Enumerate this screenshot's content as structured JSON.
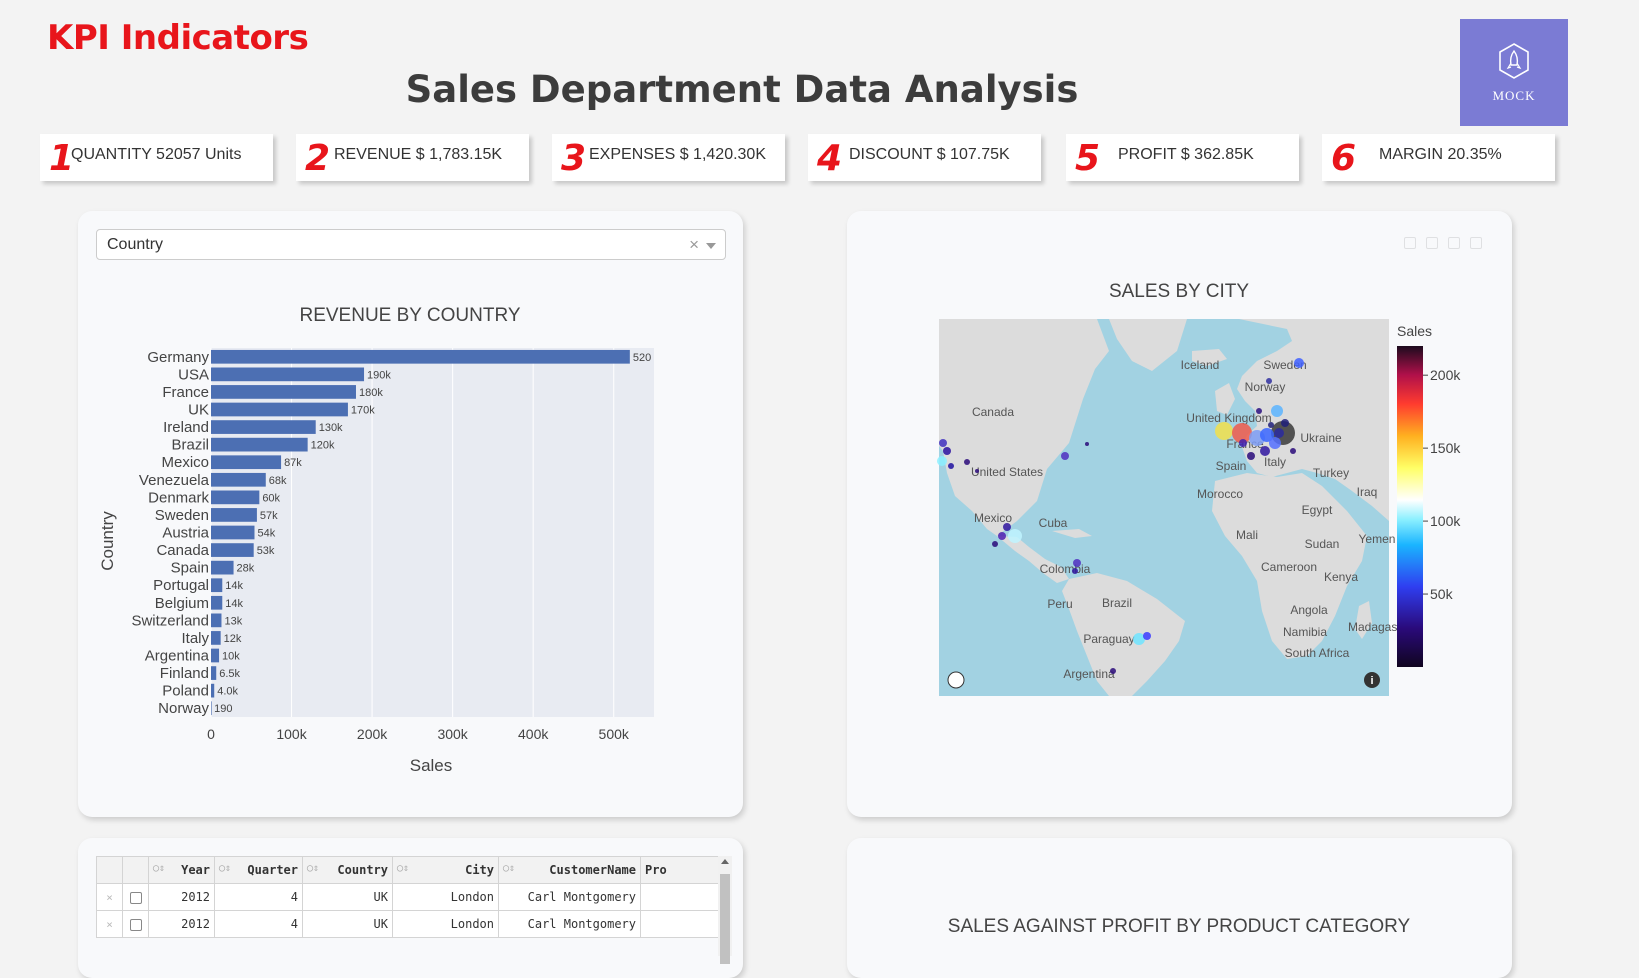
{
  "header": {
    "kpi_heading": "KPI Indicators",
    "page_title": "Sales Department Data Analysis",
    "logo_text": "MOCK",
    "logo_icon": "rocket-hexagon-icon"
  },
  "kpis": [
    {
      "num": "1",
      "label": "QUANTITY 52057 Units"
    },
    {
      "num": "2",
      "label": "REVENUE $ 1,783.15K"
    },
    {
      "num": "3",
      "label": "EXPENSES $ 1,420.30K"
    },
    {
      "num": "4",
      "label": "DISCOUNT $ 107.75K"
    },
    {
      "num": "5",
      "label": "PROFIT $ 362.85K"
    },
    {
      "num": "6",
      "label": "MARGIN 20.35%"
    }
  ],
  "country_filter": {
    "selected": "Country",
    "clear_glyph": "×"
  },
  "chart_data": [
    {
      "type": "bar",
      "orientation": "horizontal",
      "title": "REVENUE BY COUNTRY",
      "xlabel": "Sales",
      "ylabel": "Country",
      "xlim": [
        0,
        550000
      ],
      "xticks": [
        0,
        100000,
        200000,
        300000,
        400000,
        500000
      ],
      "xtick_labels": [
        "0",
        "100k",
        "200k",
        "300k",
        "400k",
        "500k"
      ],
      "grid": true,
      "bar_color": "#4c6fb3",
      "categories": [
        "Germany",
        "USA",
        "France",
        "UK",
        "Ireland",
        "Brazil",
        "Mexico",
        "Venezuela",
        "Denmark",
        "Sweden",
        "Austria",
        "Canada",
        "Spain",
        "Portugal",
        "Belgium",
        "Switzerland",
        "Italy",
        "Argentina",
        "Finland",
        "Poland",
        "Norway"
      ],
      "values": [
        520000,
        190000,
        180000,
        170000,
        130000,
        120000,
        87000,
        68000,
        60000,
        57000,
        54000,
        53000,
        28000,
        14000,
        14000,
        13000,
        12000,
        10000,
        6500,
        4000,
        190
      ],
      "data_labels": [
        "520",
        "190k",
        "180k",
        "170k",
        "130k",
        "120k",
        "87k",
        "68k",
        "60k",
        "57k",
        "54k",
        "53k",
        "28k",
        "14k",
        "14k",
        "13k",
        "12k",
        "10k",
        "6.5k",
        "4.0k",
        "190"
      ]
    },
    {
      "type": "scatter",
      "subtype": "geo-bubble-map",
      "title": "SALES BY CITY",
      "colorbar_title": "Sales",
      "colorbar_ticks": [
        "200k",
        "150k",
        "100k",
        "50k"
      ],
      "colorbar_range": [
        0,
        220000
      ],
      "map_labels": [
        "Canada",
        "Iceland",
        "Sweden",
        "Norway",
        "United Kingdom",
        "France",
        "Ukraine",
        "Italy",
        "Spain",
        "Turkey",
        "Iraq",
        "Morocco",
        "Egypt",
        "United States",
        "Mexico",
        "Cuba",
        "Mali",
        "Sudan",
        "Yemen",
        "Colombia",
        "Cameroon",
        "Kenya",
        "Peru",
        "Brazil",
        "Angola",
        "Namibia",
        "Madagascar",
        "Paraguay",
        "South Africa",
        "Argentina"
      ]
    },
    {
      "type": "scatter",
      "title": "SALES AGAINST PROFIT BY PRODUCT CATEGORY"
    }
  ],
  "table": {
    "columns": [
      "Year",
      "Quarter",
      "Country",
      "City",
      "CustomerName",
      "Pro"
    ],
    "rows": [
      [
        "2012",
        "4",
        "UK",
        "London",
        "Carl Montgomery",
        ""
      ],
      [
        "2012",
        "4",
        "UK",
        "London",
        "Carl Montgomery",
        ""
      ]
    ],
    "row_delete_glyph": "×",
    "sort_glyph": "◯⇕"
  }
}
